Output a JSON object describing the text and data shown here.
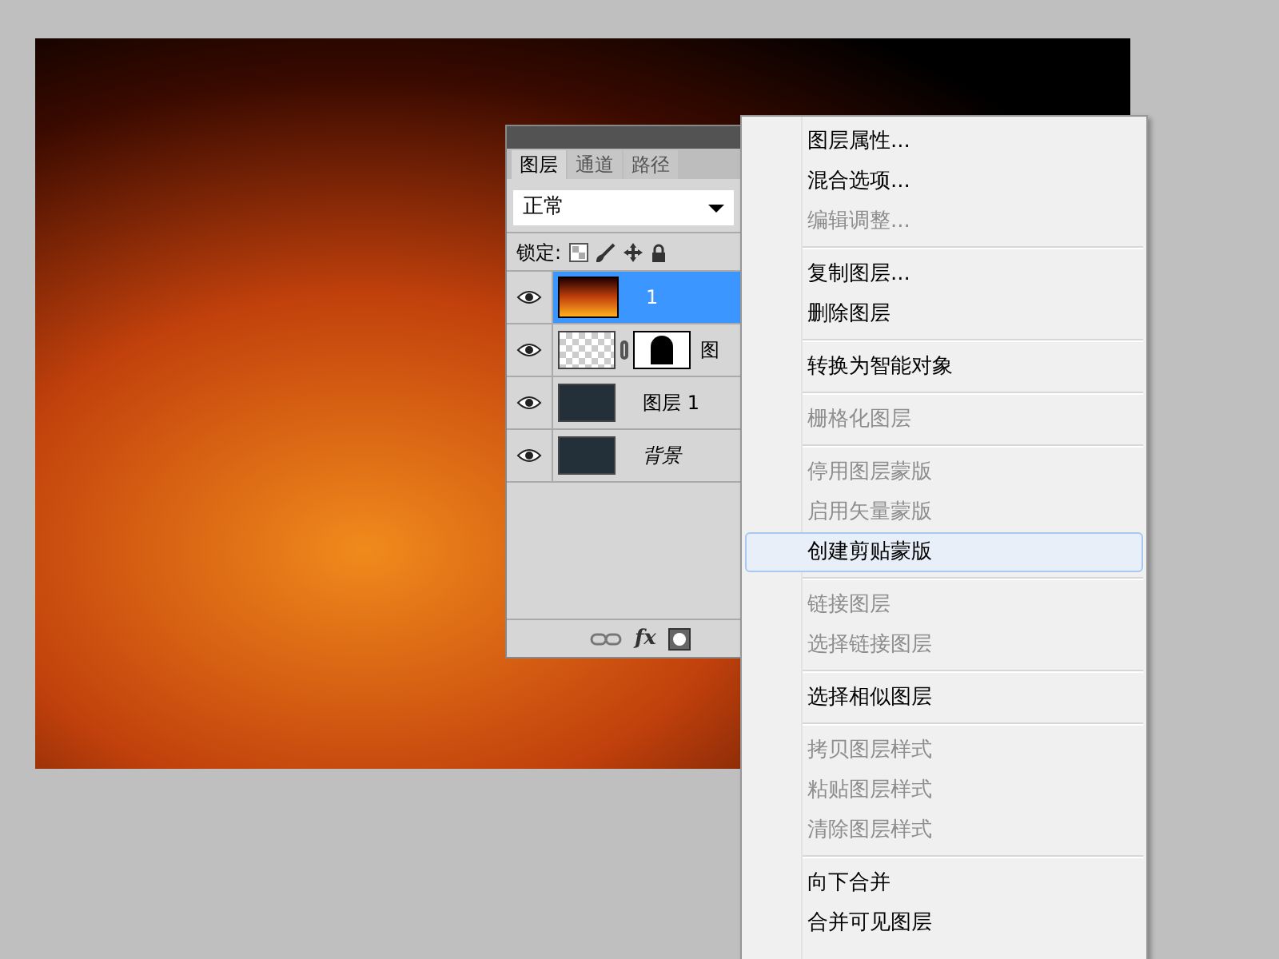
{
  "layers_panel": {
    "tabs": [
      {
        "label": "图层",
        "selected": true
      },
      {
        "label": "通道",
        "selected": false
      },
      {
        "label": "路径",
        "selected": false
      }
    ],
    "blend_mode": "正常",
    "lock_label": "锁定:",
    "layers": [
      {
        "name": "1",
        "kind": "fire",
        "selected": true,
        "visible": true
      },
      {
        "name": "图",
        "kind": "masked",
        "selected": false,
        "visible": true
      },
      {
        "name": "图层 1",
        "kind": "plain",
        "selected": false,
        "visible": true
      },
      {
        "name": "背景",
        "kind": "background",
        "selected": false,
        "visible": true
      }
    ],
    "fx_label": "fx"
  },
  "context_menu": {
    "sections": [
      [
        {
          "label": "图层属性...",
          "disabled": false,
          "selected": false
        },
        {
          "label": "混合选项...",
          "disabled": false,
          "selected": false
        },
        {
          "label": "编辑调整...",
          "disabled": true,
          "selected": false
        }
      ],
      [
        {
          "label": "复制图层...",
          "disabled": false,
          "selected": false
        },
        {
          "label": "删除图层",
          "disabled": false,
          "selected": false
        }
      ],
      [
        {
          "label": "转换为智能对象",
          "disabled": false,
          "selected": false
        }
      ],
      [
        {
          "label": "栅格化图层",
          "disabled": true,
          "selected": false
        }
      ],
      [
        {
          "label": "停用图层蒙版",
          "disabled": true,
          "selected": false
        },
        {
          "label": "启用矢量蒙版",
          "disabled": true,
          "selected": false
        },
        {
          "label": "创建剪贴蒙版",
          "disabled": false,
          "selected": true
        }
      ],
      [
        {
          "label": "链接图层",
          "disabled": true,
          "selected": false
        },
        {
          "label": "选择链接图层",
          "disabled": true,
          "selected": false
        }
      ],
      [
        {
          "label": "选择相似图层",
          "disabled": false,
          "selected": false
        }
      ],
      [
        {
          "label": "拷贝图层样式",
          "disabled": true,
          "selected": false
        },
        {
          "label": "粘贴图层样式",
          "disabled": true,
          "selected": false
        },
        {
          "label": "清除图层样式",
          "disabled": true,
          "selected": false
        }
      ],
      [
        {
          "label": "向下合并",
          "disabled": false,
          "selected": false
        },
        {
          "label": "合并可见图层",
          "disabled": false,
          "selected": false
        }
      ]
    ]
  }
}
